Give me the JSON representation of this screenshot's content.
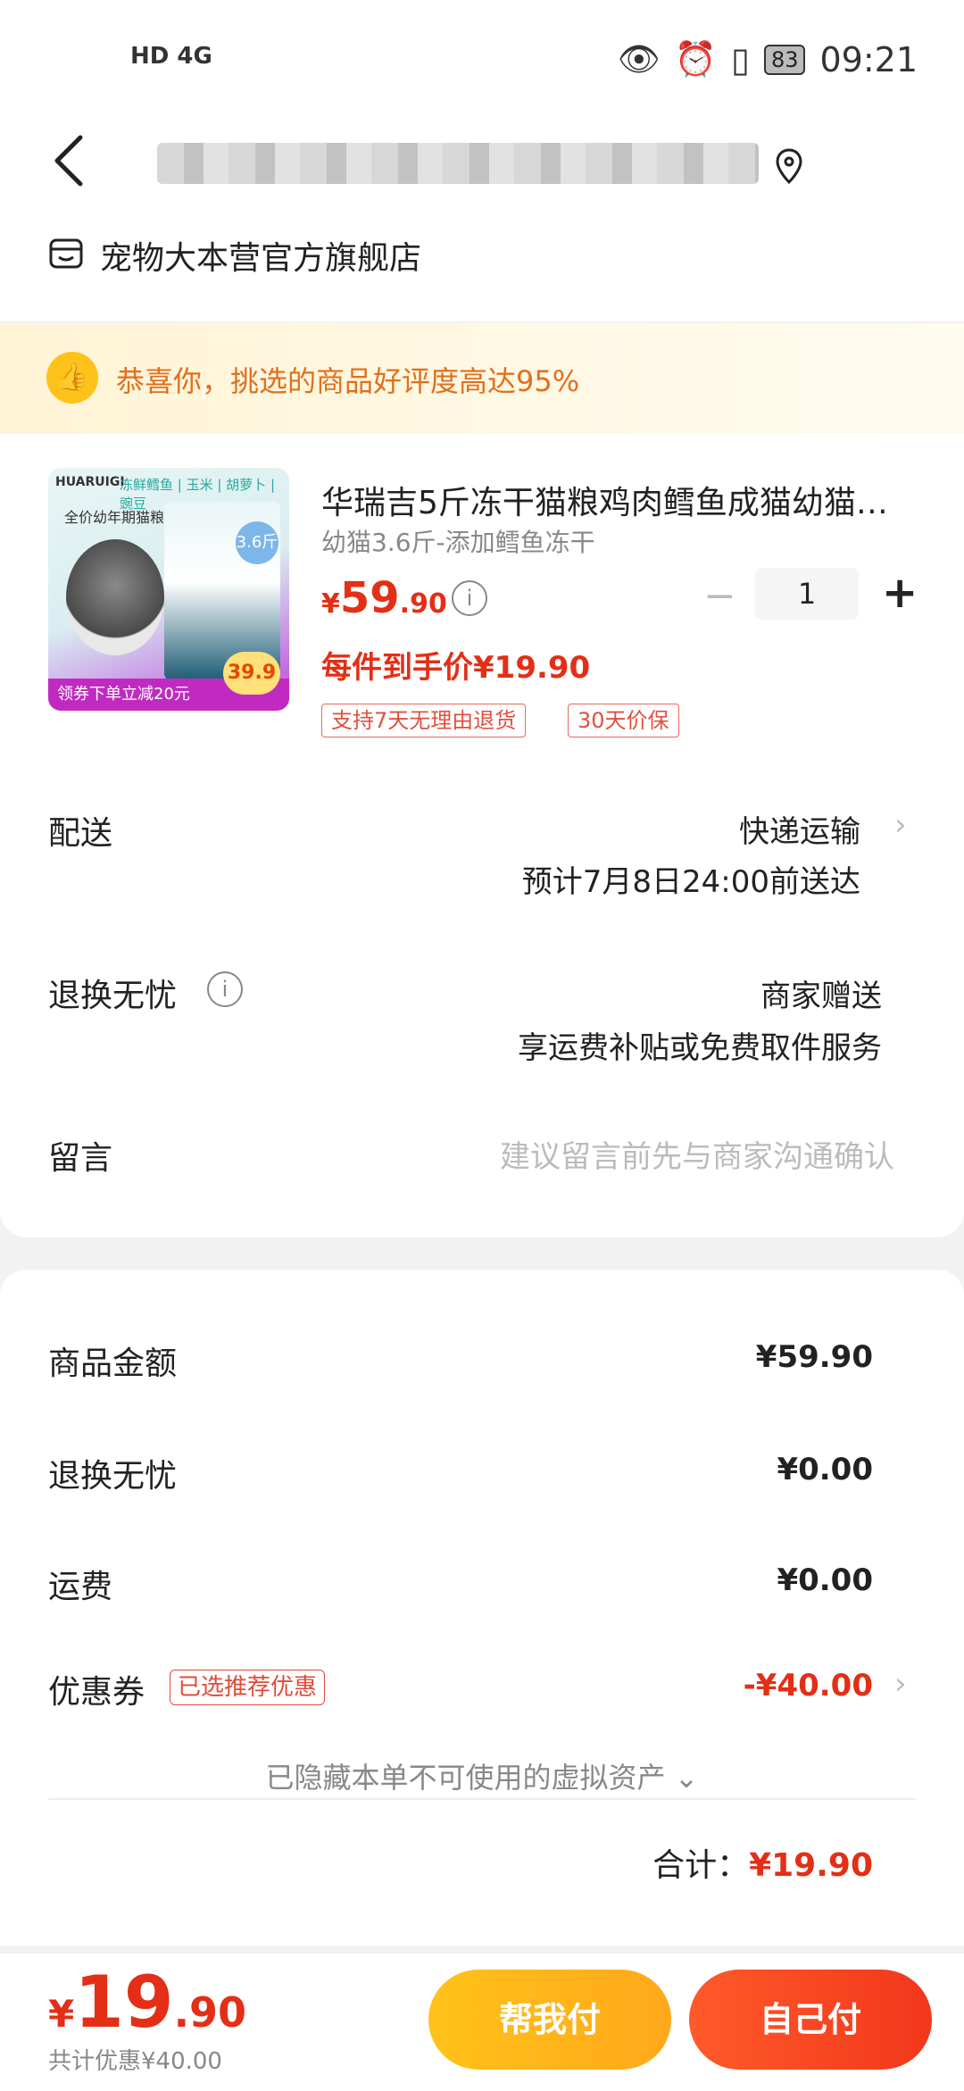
{
  "status_bar": {
    "network": "HD 4G",
    "battery": "83",
    "time": "09:21"
  },
  "header": {
    "store_name": "宠物大本营官方旗舰店"
  },
  "banner": {
    "text": "恭喜你，挑选的商品好评度高达95%"
  },
  "product": {
    "image": {
      "brand": "HUARUIGI",
      "tags": "冻鲜鳕鱼 | 玉米 | 胡萝卜 | 豌豆",
      "title": "全价幼年期猫粮",
      "weight_badge": "3.6斤",
      "footer": "领券下单立减20元",
      "promo_price": "39.9"
    },
    "title": "华瑞吉5斤冻干猫粮鸡肉鳕鱼成猫幼猫…",
    "spec": "幼猫3.6斤-添加鳕鱼冻干",
    "price_currency": "¥",
    "price_int": "59",
    "price_dec": ".90",
    "quantity": "1",
    "unit_price_text": "每件到手价¥19.90",
    "tags": [
      "支持7天无理由退货",
      "30天价保"
    ]
  },
  "delivery": {
    "label": "配送",
    "method": "快递运输",
    "eta": "预计7月8日24:00前送达"
  },
  "returns": {
    "label": "退换无忧",
    "value": "商家赠送",
    "desc": "享运费补贴或免费取件服务"
  },
  "message": {
    "label": "留言",
    "placeholder": "建议留言前先与商家沟通确认"
  },
  "summary": {
    "goods_label": "商品金额",
    "goods_value": "¥59.90",
    "returns_label": "退换无忧",
    "returns_value": "¥0.00",
    "shipping_label": "运费",
    "shipping_value": "¥0.00",
    "coupon_label": "优惠券",
    "coupon_tag": "已选推荐优惠",
    "coupon_value": "-¥40.00",
    "hidden_assets": "已隐藏本单不可使用的虚拟资产 ⌄",
    "total_label": "合计：",
    "total_value": "¥19.90"
  },
  "bottom_bar": {
    "price_currency": "¥",
    "price_int": "19",
    "price_dec": ".90",
    "saved": "共计优惠¥40.00",
    "help_pay": "帮我付",
    "self_pay": "自己付"
  },
  "colors": {
    "accent_red": "#e32f16",
    "accent_yellow": "#ffc21a",
    "banner_text": "#e0701d"
  }
}
